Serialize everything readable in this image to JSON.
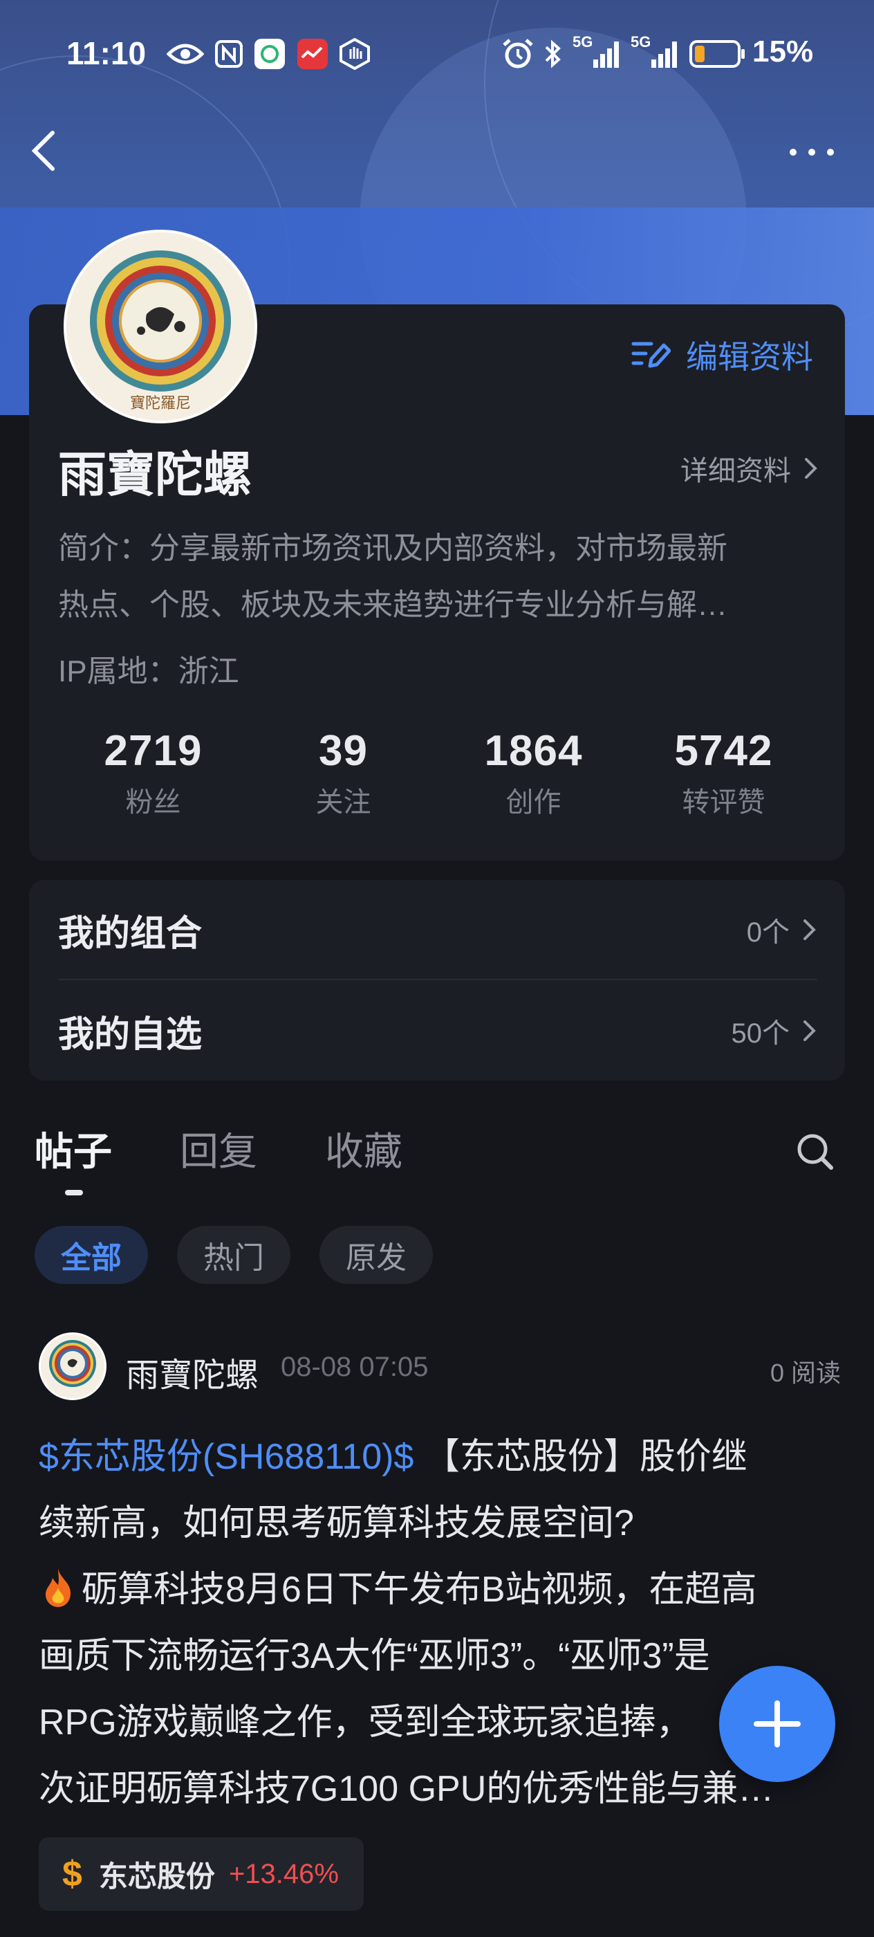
{
  "status_bar": {
    "time": "11:10",
    "battery_percent": "15%",
    "signal_label_1": "5G",
    "signal_label_2": "5G",
    "battery_level": 0.15,
    "icons": [
      "eye-icon",
      "nfc-icon",
      "app-notification-icon",
      "app-notification-icon",
      "hand-icon",
      "alarm-icon",
      "bluetooth-icon",
      "signal-5g-icon",
      "signal-5g-icon",
      "battery-icon"
    ]
  },
  "nav": {
    "back_icon": "chevron-left-icon",
    "more_icon": "more-dots-icon"
  },
  "profile": {
    "name": "雨寶陀螺",
    "edit_label": "编辑资料",
    "detail_label": "详细资料",
    "bio_line1": "简介：分享最新市场资讯及内部资料，对市场最新",
    "bio_line2": "热点、个股、板块及未来趋势进行专业分析与解…",
    "ip_location": "IP属地：浙江",
    "stats": [
      {
        "value": "2719",
        "label": "粉丝"
      },
      {
        "value": "39",
        "label": "关注"
      },
      {
        "value": "1864",
        "label": "创作"
      },
      {
        "value": "5742",
        "label": "转评赞"
      }
    ]
  },
  "lists": [
    {
      "title": "我的组合",
      "count": "0个"
    },
    {
      "title": "我的自选",
      "count": "50个"
    }
  ],
  "tabs": [
    {
      "label": "帖子",
      "active": true
    },
    {
      "label": "回复",
      "active": false
    },
    {
      "label": "收藏",
      "active": false
    }
  ],
  "filters": [
    {
      "label": "全部",
      "active": true
    },
    {
      "label": "热门",
      "active": false
    },
    {
      "label": "原发",
      "active": false
    }
  ],
  "post": {
    "author": "雨寶陀螺",
    "time": "08-08 07:05",
    "reads": "0 阅读",
    "stock_link": "$东芯股份(SH688110)$",
    "line1_rest": " 【东芯股份】股价继",
    "line2": "续新高，如何思考砺算科技发展空间?",
    "line3": "砺算科技8月6日下午发布B站视频，在超高",
    "line4": "画质下流畅运行3A大作“巫师3”。“巫师3”是",
    "line5": "RPG游戏巅峰之作，受到全球玩家追捧，",
    "line6": "次证明砺算科技7G100 GPU的优秀性能与兼…",
    "tag": {
      "symbol": "$",
      "name": "东芯股份",
      "change": "+13.46%"
    }
  },
  "colors": {
    "accent": "#4f8ef7",
    "up": "#f0504f",
    "background": "#14161c",
    "card": "#1c1e25"
  }
}
